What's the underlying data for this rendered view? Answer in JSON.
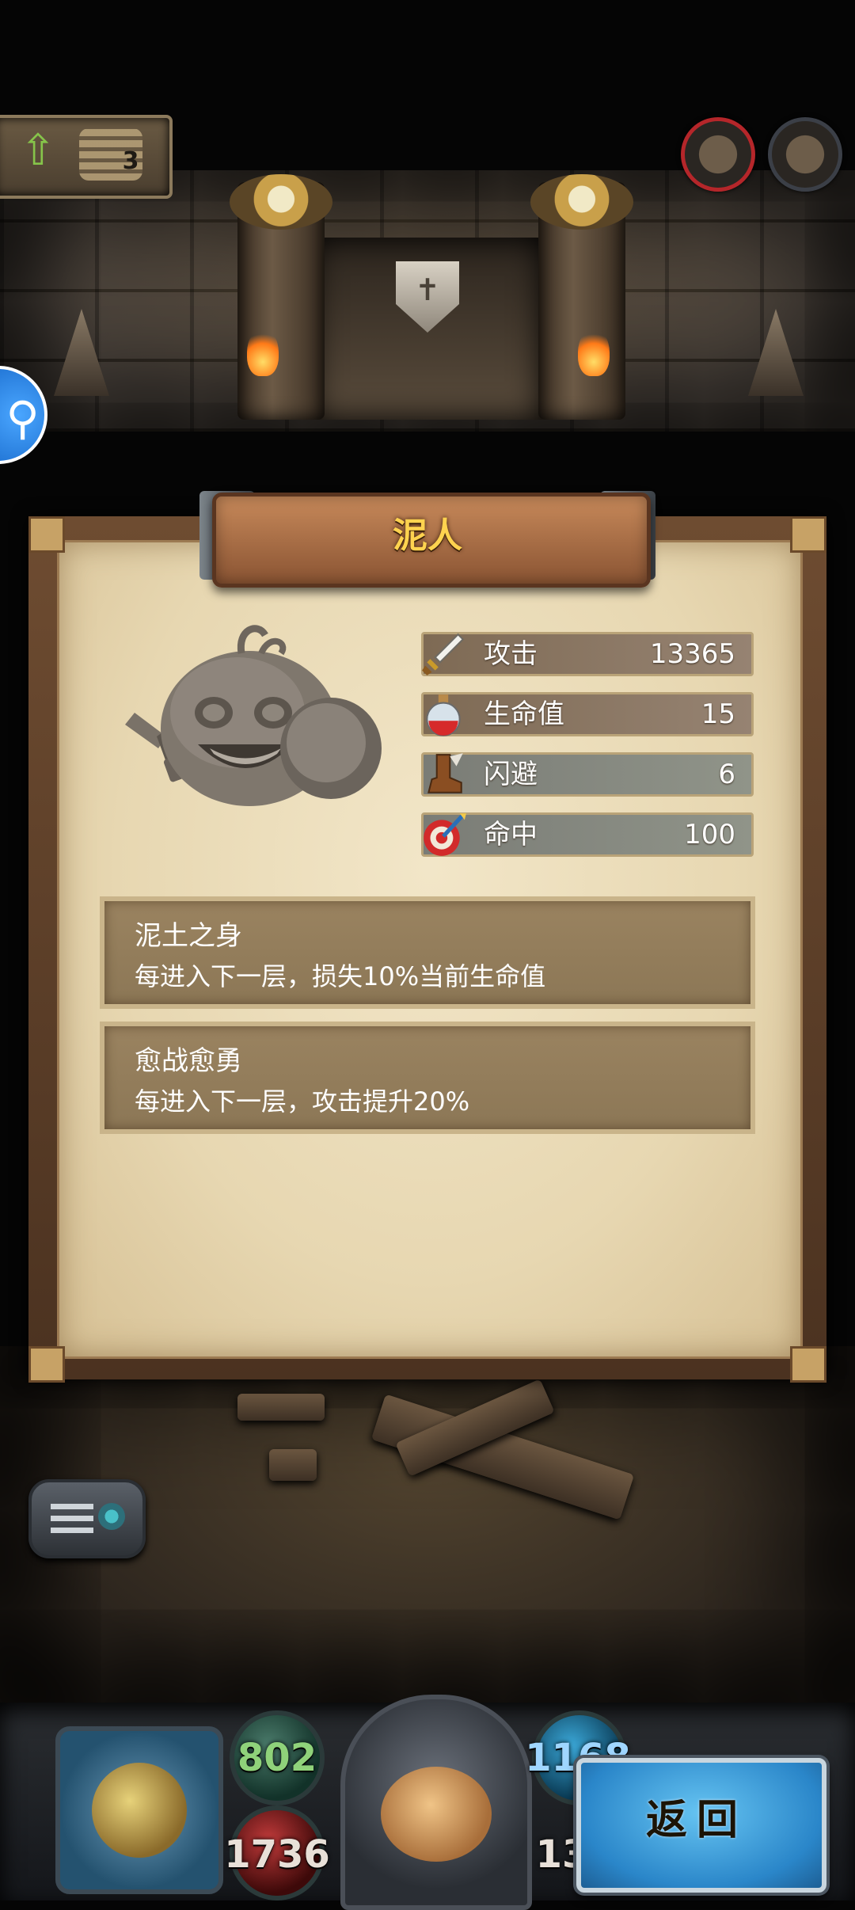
{
  "hud": {
    "floor_number": "3",
    "stat_attack": "802",
    "stat_hp": "1736",
    "stat_mana_partial": "1168",
    "stat_gold_partial": "13"
  },
  "monster_card": {
    "name": "泥人",
    "stats": [
      {
        "icon": "sword-icon",
        "label": "攻击",
        "value": "13365"
      },
      {
        "icon": "potion-icon",
        "label": "生命值",
        "value": "15"
      },
      {
        "icon": "boot-icon",
        "label": "闪避",
        "value": "6"
      },
      {
        "icon": "target-icon",
        "label": "命中",
        "value": "100"
      }
    ],
    "skills": [
      {
        "name": "泥土之身",
        "desc": "每进入下一层，损失10%当前生命值"
      },
      {
        "name": "愈战愈勇",
        "desc": "每进入下一层，攻击提升20%"
      }
    ]
  },
  "buttons": {
    "back_label": "返回"
  },
  "colors": {
    "title_text": "#ffd34f",
    "parchment": "#ecdcb6",
    "back_button": "#3d9bdc"
  }
}
